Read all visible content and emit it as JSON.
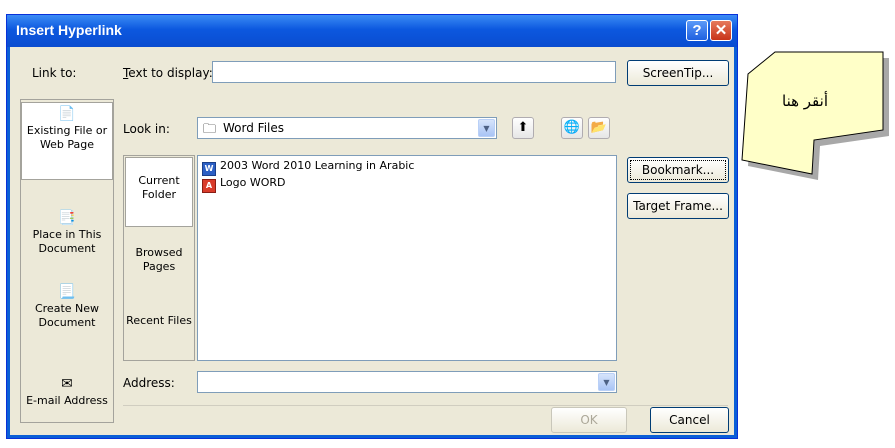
{
  "dialog": {
    "title": "Insert Hyperlink",
    "help_btn": "?",
    "close_btn": "✕"
  },
  "link_to": {
    "label": "Link to:",
    "items": [
      {
        "label": "Existing File or Web Page",
        "icon": "web-page-icon",
        "selected": true
      },
      {
        "label": "Place in This Document",
        "icon": "document-place-icon",
        "selected": false
      },
      {
        "label": "Create New Document",
        "icon": "new-document-icon",
        "selected": false
      },
      {
        "label": "E-mail Address",
        "icon": "email-icon",
        "selected": false
      }
    ]
  },
  "text_to_display": {
    "label": "Text to display:",
    "value": ""
  },
  "screentip_button": "ScreenTip...",
  "look_in": {
    "label": "Look in:",
    "value": "Word Files"
  },
  "view_tabs": [
    {
      "label": "Current Folder",
      "selected": true
    },
    {
      "label": "Browsed Pages",
      "selected": false
    },
    {
      "label": "Recent Files",
      "selected": false
    }
  ],
  "files": [
    {
      "name": "2003 Word 2010 Learning in Arabic",
      "type": "word"
    },
    {
      "name": "Logo WORD",
      "type": "pdf"
    }
  ],
  "file_type_glyphs": {
    "word": "W",
    "pdf": "A"
  },
  "bookmark_button": "Bookmark...",
  "target_frame_button": "Target Frame...",
  "address": {
    "label": "Address:",
    "value": ""
  },
  "ok_button": "OK",
  "cancel_button": "Cancel",
  "callout": {
    "text": "أنقر هنا"
  },
  "colors": {
    "titlebar": "#0a5fd6",
    "dialog_bg": "#ece9d8",
    "callout_fill": "#ffffc8"
  }
}
